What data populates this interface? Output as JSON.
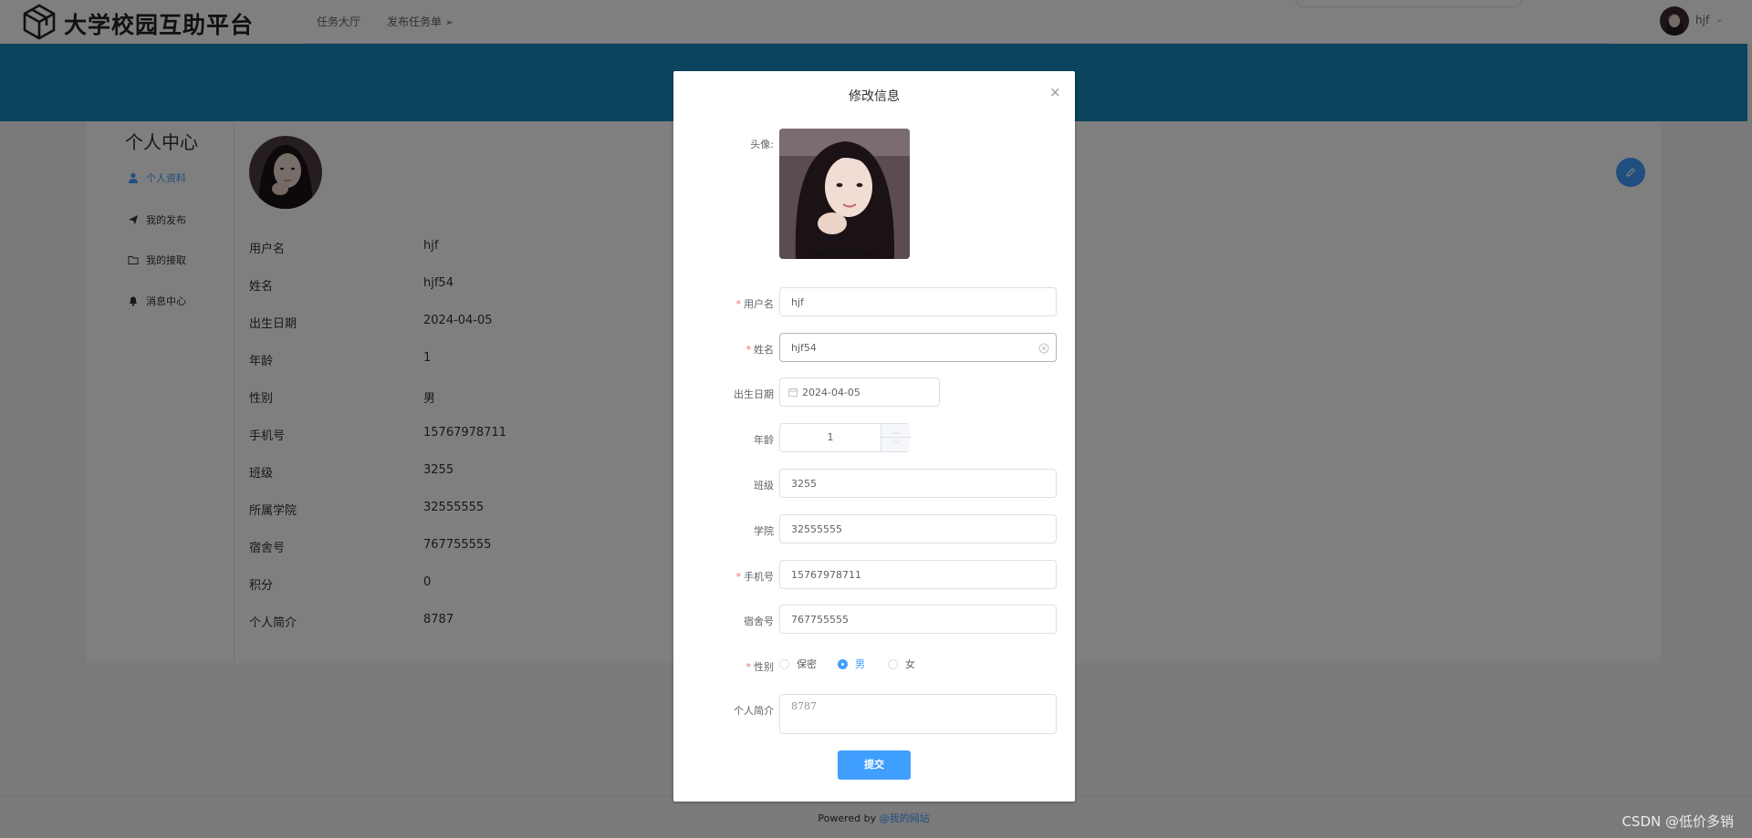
{
  "header": {
    "brand": "大学校园互助平台",
    "nav": [
      "任务大厅",
      "发布任务单"
    ],
    "username": "hjf"
  },
  "sidebar": {
    "title": "个人中心",
    "items": [
      {
        "label": "个人资料",
        "icon": "user-icon",
        "active": true
      },
      {
        "label": "我的发布",
        "icon": "send-icon",
        "active": false
      },
      {
        "label": "我的接取",
        "icon": "folder-icon",
        "active": false
      },
      {
        "label": "消息中心",
        "icon": "bell-icon",
        "active": false
      }
    ]
  },
  "profile": {
    "rows": [
      {
        "label": "用户名",
        "value": "hjf"
      },
      {
        "label": "姓名",
        "value": "hjf54"
      },
      {
        "label": "出生日期",
        "value": "2024-04-05"
      },
      {
        "label": "年龄",
        "value": "1"
      },
      {
        "label": "性别",
        "value": "男"
      },
      {
        "label": "手机号",
        "value": "15767978711"
      },
      {
        "label": "班级",
        "value": "3255"
      },
      {
        "label": "所属学院",
        "value": "32555555"
      },
      {
        "label": "宿舍号",
        "value": "767755555"
      },
      {
        "label": "积分",
        "value": "0"
      },
      {
        "label": "个人简介",
        "value": "8787"
      }
    ]
  },
  "dialog": {
    "title": "修改信息",
    "close": "×",
    "labels": {
      "avatar": "头像:",
      "username": "用户名",
      "name": "姓名",
      "birth": "出生日期",
      "age": "年龄",
      "class": "班级",
      "college": "学院",
      "phone": "手机号",
      "dorm": "宿舍号",
      "gender": "性别",
      "bio": "个人简介"
    },
    "values": {
      "username": "hjf",
      "name": "hjf54",
      "birth": "2024-04-05",
      "age": "1",
      "class": "3255",
      "college": "32555555",
      "phone": "15767978711",
      "dorm": "767755555",
      "bio": "8787"
    },
    "gender_options": [
      "保密",
      "男",
      "女"
    ],
    "gender_selected": "男",
    "submit": "提交"
  },
  "footer": {
    "prefix": "Powered by",
    "link": "@我的网站"
  },
  "watermark": "CSDN @低价多销",
  "colors": {
    "primary": "#409eff",
    "banner": "#1688bd",
    "required": "#f56c6c"
  }
}
